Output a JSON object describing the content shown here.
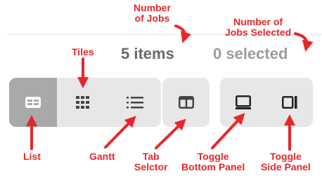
{
  "status": {
    "items_count": "5 items",
    "selected_count": "0 selected"
  },
  "toolbar": {
    "buttons": [
      {
        "icon": "list-view-icon",
        "active": true
      },
      {
        "icon": "tiles-view-icon",
        "active": false
      },
      {
        "icon": "gantt-view-icon",
        "active": false
      },
      {
        "icon": "tab-selector-icon",
        "active": false
      },
      {
        "icon": "toggle-bottom-panel-icon",
        "active": false
      },
      {
        "icon": "toggle-side-panel-icon",
        "active": false
      }
    ]
  },
  "annotations": {
    "number_of_jobs": [
      "Number",
      "of Jobs"
    ],
    "number_of_jobs_selected": [
      "Number of",
      "Jobs Selected"
    ],
    "tiles": "Tiles",
    "list": "List",
    "gantt": "Gantt",
    "tab_selector": [
      "Tab",
      "Selctor"
    ],
    "toggle_bottom_panel": [
      "Toggle",
      "Bottom Panel"
    ],
    "toggle_side_panel": [
      "Toggle",
      "Side Panel"
    ]
  },
  "colors": {
    "annotation": "#e8262a",
    "button_bg": "#e7e7e7",
    "button_active_bg": "#a9a9a9",
    "icon": "#444444"
  }
}
